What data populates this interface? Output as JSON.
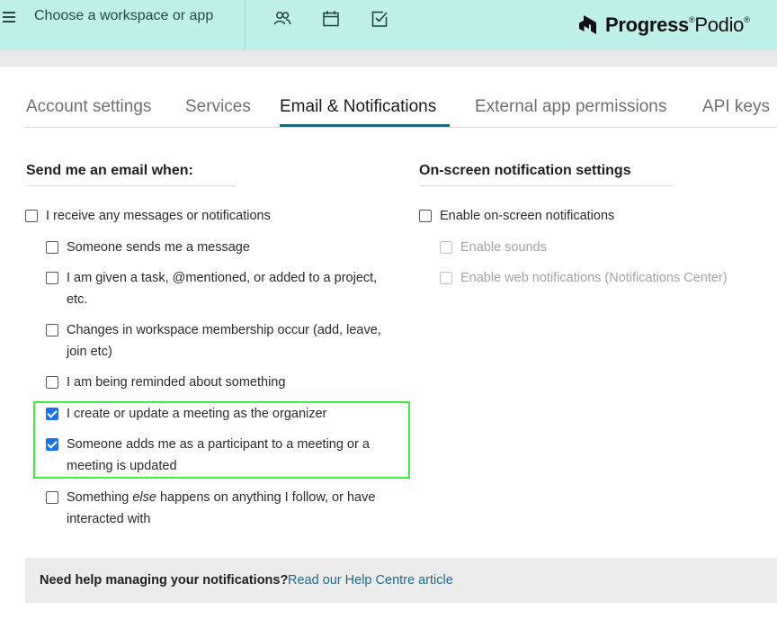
{
  "header": {
    "workspace_switcher": "Choose a workspace or app",
    "icons": [
      "people-icon",
      "calendar-icon",
      "tasks-check-icon"
    ],
    "logo": {
      "brand": "Progress",
      "product": "Podio",
      "reg": "®"
    },
    "colors": {
      "header_bg": "#bff0ea",
      "accent": "#1d6b7a"
    }
  },
  "tabs": [
    {
      "label": "Account settings"
    },
    {
      "label": "Services"
    },
    {
      "label": "Email & Notifications",
      "active": true
    },
    {
      "label": "External app permissions"
    },
    {
      "label": "API keys"
    }
  ],
  "email": {
    "title": "Send me an email when:",
    "master": {
      "label": "I receive any messages or notifications",
      "checked": false
    },
    "items": [
      {
        "label": "Someone sends me a message",
        "checked": false
      },
      {
        "label": "I am given a task, @mentioned, or added to a project, etc.",
        "checked": false
      },
      {
        "label": "Changes in workspace membership occur (add, leave, join etc)",
        "checked": false
      },
      {
        "label": "I am being reminded about something",
        "checked": false
      },
      {
        "label": "I create or update a meeting as the organizer",
        "checked": true
      },
      {
        "label": "Someone adds me as a participant to a meeting or a meeting is updated",
        "checked": true
      },
      {
        "label_pre": "Something ",
        "label_em": "else",
        "label_post": " happens on anything I follow, or have interacted with",
        "checked": false
      }
    ]
  },
  "onscreen": {
    "title": "On-screen notification settings",
    "master": {
      "label": "Enable on-screen notifications",
      "checked": false
    },
    "items": [
      {
        "label": "Enable sounds",
        "checked": false,
        "disabled": true
      },
      {
        "label": "Enable web notifications (Notifications Center)",
        "checked": false,
        "disabled": true
      }
    ]
  },
  "help": {
    "question": "Need help managing your notifications?",
    "link": "Read our Help Centre article"
  }
}
